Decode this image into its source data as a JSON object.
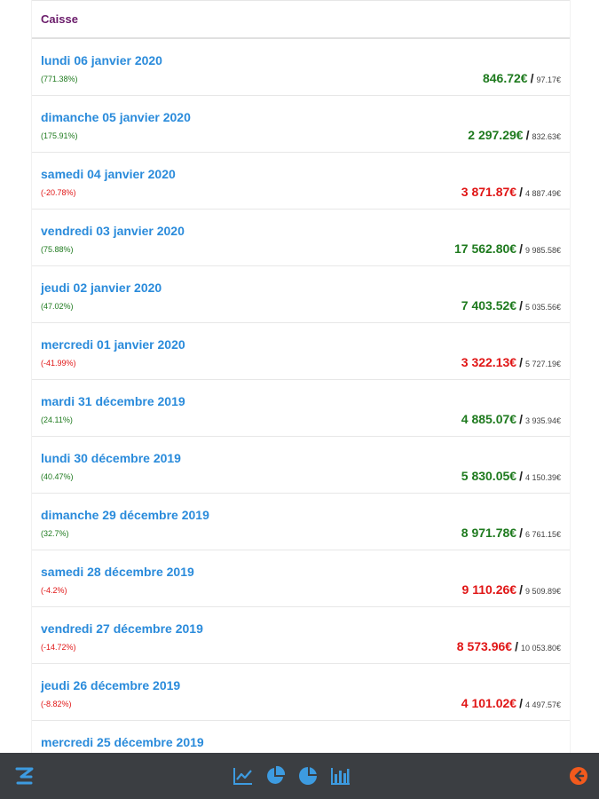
{
  "header": {
    "title": "Caisse"
  },
  "rows": [
    {
      "date": "lundi 06 janvier 2020",
      "pct": "(771.38%)",
      "amount": "846.72€",
      "ref": "97.17€",
      "trend": "up"
    },
    {
      "date": "dimanche 05 janvier 2020",
      "pct": "(175.91%)",
      "amount": "2 297.29€",
      "ref": "832.63€",
      "trend": "up"
    },
    {
      "date": "samedi 04 janvier 2020",
      "pct": "(-20.78%)",
      "amount": "3 871.87€",
      "ref": "4 887.49€",
      "trend": "down"
    },
    {
      "date": "vendredi 03 janvier 2020",
      "pct": "(75.88%)",
      "amount": "17 562.80€",
      "ref": "9 985.58€",
      "trend": "up"
    },
    {
      "date": "jeudi 02 janvier 2020",
      "pct": "(47.02%)",
      "amount": "7 403.52€",
      "ref": "5 035.56€",
      "trend": "up"
    },
    {
      "date": "mercredi 01 janvier 2020",
      "pct": "(-41.99%)",
      "amount": "3 322.13€",
      "ref": "5 727.19€",
      "trend": "down"
    },
    {
      "date": "mardi 31 décembre 2019",
      "pct": "(24.11%)",
      "amount": "4 885.07€",
      "ref": "3 935.94€",
      "trend": "up"
    },
    {
      "date": "lundi 30 décembre 2019",
      "pct": "(40.47%)",
      "amount": "5 830.05€",
      "ref": "4 150.39€",
      "trend": "up"
    },
    {
      "date": "dimanche 29 décembre 2019",
      "pct": "(32.7%)",
      "amount": "8 971.78€",
      "ref": "6 761.15€",
      "trend": "up"
    },
    {
      "date": "samedi 28 décembre 2019",
      "pct": "(-4.2%)",
      "amount": "9 110.26€",
      "ref": "9 509.89€",
      "trend": "down"
    },
    {
      "date": "vendredi 27 décembre 2019",
      "pct": "(-14.72%)",
      "amount": "8 573.96€",
      "ref": "10 053.80€",
      "trend": "down"
    },
    {
      "date": "jeudi 26 décembre 2019",
      "pct": "(-8.82%)",
      "amount": "4 101.02€",
      "ref": "4 497.57€",
      "trend": "down"
    },
    {
      "date": "mercredi 25 décembre 2019",
      "pct": "",
      "amount": "",
      "ref": "",
      "trend": "up"
    }
  ],
  "separator": "/",
  "colors": {
    "date": "#2a8bdb",
    "up": "#1e7a1e",
    "down": "#e01515",
    "header": "#6a1b6a",
    "bottombar": "#3b3e42",
    "icon": "#3d9be0",
    "back": "#f25a1d"
  },
  "bottom_bar": {
    "icons": [
      "logo-icon",
      "line-chart-icon",
      "pie-chart-icon",
      "pie-chart-alt-icon",
      "bar-chart-icon",
      "back-icon"
    ]
  }
}
